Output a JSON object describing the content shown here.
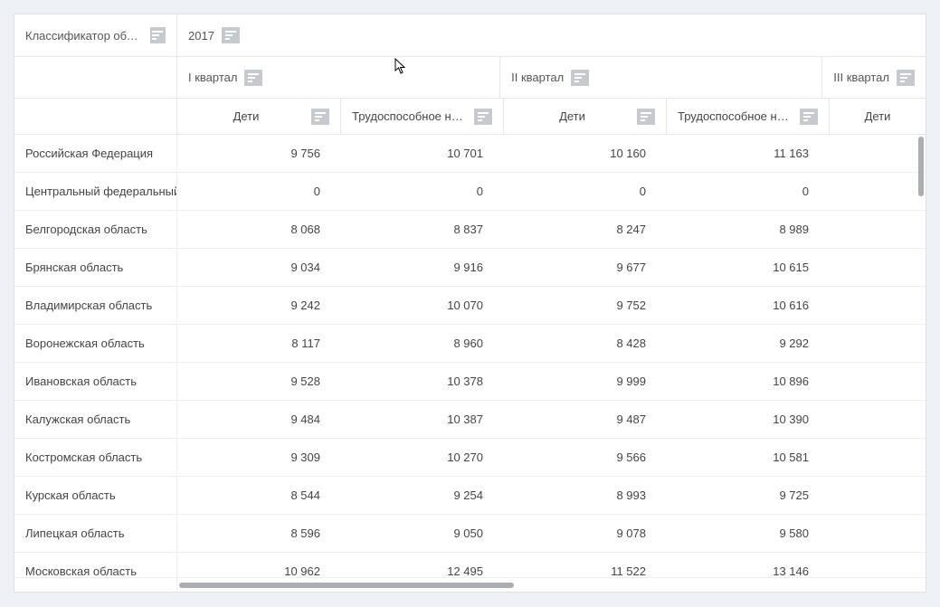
{
  "header": {
    "classifier": "Классификатор объект...",
    "year": "2017",
    "quarters": [
      "I квартал",
      "II квартал",
      "III квартал"
    ],
    "metrics": {
      "children": "Дети",
      "working": "Трудоспособное на..."
    }
  },
  "rows": [
    {
      "label": "Российская Федерация",
      "q1c": "9 756",
      "q1w": "10 701",
      "q2c": "10 160",
      "q2w": "11 163"
    },
    {
      "label": "Центральный федеральный...",
      "q1c": "0",
      "q1w": "0",
      "q2c": "0",
      "q2w": "0"
    },
    {
      "label": "Белгородская область",
      "q1c": "8 068",
      "q1w": "8 837",
      "q2c": "8 247",
      "q2w": "8 989"
    },
    {
      "label": "Брянская область",
      "q1c": "9 034",
      "q1w": "9 916",
      "q2c": "9 677",
      "q2w": "10 615"
    },
    {
      "label": "Владимирская область",
      "q1c": "9 242",
      "q1w": "10 070",
      "q2c": "9 752",
      "q2w": "10 616"
    },
    {
      "label": "Воронежская область",
      "q1c": "8 117",
      "q1w": "8 960",
      "q2c": "8 428",
      "q2w": "9 292"
    },
    {
      "label": "Ивановская область",
      "q1c": "9 528",
      "q1w": "10 378",
      "q2c": "9 999",
      "q2w": "10 896"
    },
    {
      "label": "Калужская область",
      "q1c": "9 484",
      "q1w": "10 387",
      "q2c": "9 487",
      "q2w": "10 390"
    },
    {
      "label": "Костромская область",
      "q1c": "9 309",
      "q1w": "10 270",
      "q2c": "9 566",
      "q2w": "10 581"
    },
    {
      "label": "Курская область",
      "q1c": "8 544",
      "q1w": "9 254",
      "q2c": "8 993",
      "q2w": "9 725"
    },
    {
      "label": "Липецкая область",
      "q1c": "8 596",
      "q1w": "9 050",
      "q2c": "9 078",
      "q2w": "9 580"
    },
    {
      "label": "Московская область",
      "q1c": "10 962",
      "q1w": "12 495",
      "q2c": "11 522",
      "q2w": "13 146"
    }
  ]
}
